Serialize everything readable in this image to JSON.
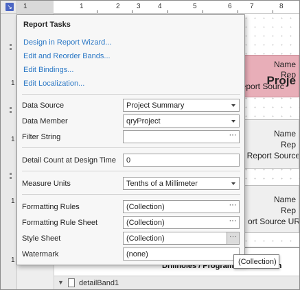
{
  "ruler": {
    "labels": [
      "1",
      "1",
      "2",
      "3",
      "4",
      "5",
      "6",
      "7",
      "8"
    ],
    "vlabels": [
      "1",
      "1",
      "1",
      "1"
    ]
  },
  "panel": {
    "title": "Report Tasks",
    "links": [
      "Design in Report Wizard...",
      "Edit and Reorder Bands...",
      "Edit Bindings...",
      "Edit Localization..."
    ],
    "props": {
      "data_source": {
        "label": "Data Source",
        "value": "Project Summary"
      },
      "data_member": {
        "label": "Data Member",
        "value": "qryProject"
      },
      "filter_string": {
        "label": "Filter String",
        "value": ""
      },
      "detail_count": {
        "label": "Detail Count at Design Time",
        "value": "0"
      },
      "measure_units": {
        "label": "Measure Units",
        "value": "Tenths of a Millimeter"
      },
      "formatting_rules": {
        "label": "Formatting Rules",
        "value": "(Collection)"
      },
      "formatting_rule_sheet": {
        "label": "Formatting Rule Sheet",
        "value": "(Collection)"
      },
      "style_sheet": {
        "label": "Style Sheet",
        "value": "(Collection)"
      },
      "watermark": {
        "label": "Watermark",
        "value": "(none)"
      }
    },
    "ellipsis": "···"
  },
  "canvas": {
    "pink": {
      "l1": "Name",
      "l2": "Rep",
      "l3": "Proje",
      "l4": "Report Sourc"
    },
    "gray1": {
      "l1": "Name",
      "l2": "Rep",
      "l3": "Report Source"
    },
    "gray2": {
      "l1": "Name",
      "l2": "Rep",
      "l3": "ort Source UR"
    },
    "bottom_text": "Drillholes / Program",
    "bottom_suffix": "th"
  },
  "band": {
    "label": "detailBand1"
  },
  "tooltip": {
    "text": "(Collection)"
  },
  "colors": {
    "link": "#2a77c5",
    "pink_band": "#e8aeb8",
    "corner": "#4b66c4"
  }
}
